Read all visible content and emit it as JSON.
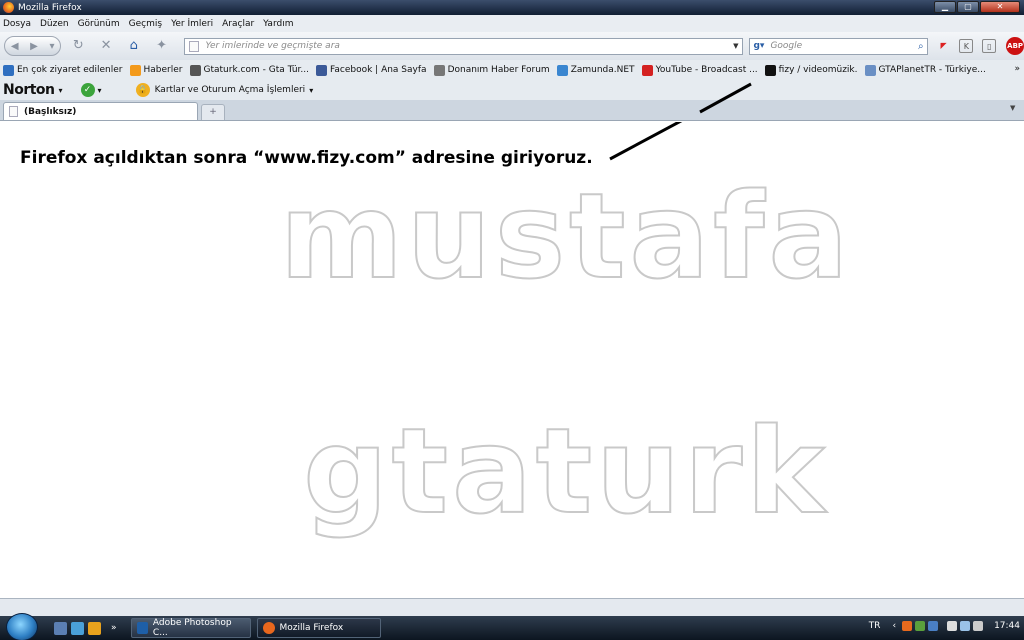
{
  "window": {
    "title": "Mozilla Firefox"
  },
  "menu": [
    "Dosya",
    "Düzen",
    "Görünüm",
    "Geçmiş",
    "Yer İmleri",
    "Araçlar",
    "Yardım"
  ],
  "nav": {
    "url_placeholder": "Yer imlerinde ve geçmişte ara",
    "search_placeholder": "Google"
  },
  "bookmarks": [
    {
      "label": "En çok ziyaret edilenler",
      "icon": "most-visited-icon",
      "color": "#2f6fc0"
    },
    {
      "label": "Haberler",
      "icon": "rss-icon",
      "color": "#f39a1c"
    },
    {
      "label": "Gtaturk.com - Gta Tür...",
      "icon": "gtaturk-icon",
      "color": "#555555"
    },
    {
      "label": "Facebook | Ana Sayfa",
      "icon": "facebook-icon",
      "color": "#3b5998"
    },
    {
      "label": "Donanım Haber Forum",
      "icon": "donanim-icon",
      "color": "#777777"
    },
    {
      "label": "Zamunda.NET",
      "icon": "zamunda-icon",
      "color": "#3a86d0"
    },
    {
      "label": "YouTube - Broadcast ...",
      "icon": "youtube-icon",
      "color": "#d42121"
    },
    {
      "label": "fizy / videomüzik.",
      "icon": "fizy-icon",
      "color": "#111111"
    },
    {
      "label": "GTAPlanetTR - Türkiye...",
      "icon": "gtaplanet-icon",
      "color": "#6a8fc4"
    }
  ],
  "norton": {
    "brand": "Norton",
    "idsafe_label": "Kartlar ve Oturum Açma İşlemleri"
  },
  "tabs": [
    {
      "label": "(Başlıksız)"
    }
  ],
  "content": {
    "instruction": "Firefox açıldıktan sonra “www.fizy.com” adresine giriyoruz.",
    "watermark_line1": "mustafa",
    "watermark_line2": "gtaturk"
  },
  "taskbar": {
    "items": [
      {
        "label": "Adobe Photoshop C...",
        "color": "#1e5fa8"
      },
      {
        "label": "Mozilla Firefox",
        "color": "#e8671d"
      }
    ],
    "language": "TR",
    "clock": "17:44"
  }
}
